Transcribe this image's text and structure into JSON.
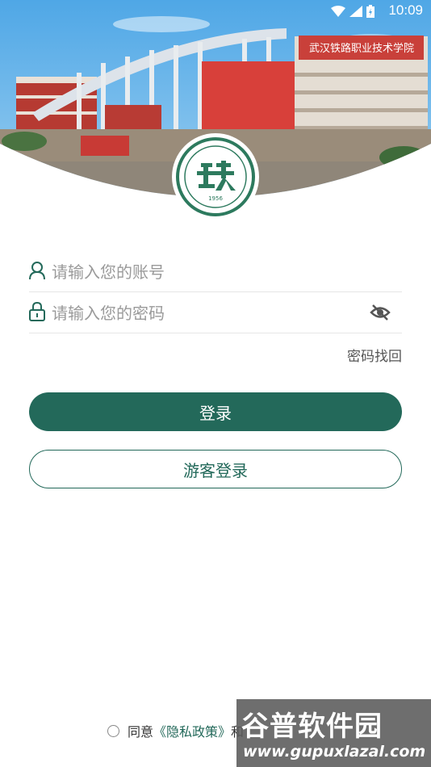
{
  "status_bar": {
    "time": "10:09"
  },
  "header": {
    "building_sign": "武汉铁路职业技术学院",
    "logo_year": "1956"
  },
  "form": {
    "account_placeholder": "请输入您的账号",
    "password_placeholder": "请输入您的密码",
    "recover_password": "密码找回"
  },
  "buttons": {
    "login": "登录",
    "guest_login": "游客登录"
  },
  "agreement": {
    "prefix": "同意",
    "privacy_link": "《隐私政策》",
    "suffix": "和"
  },
  "watermark": {
    "title": "谷普软件园",
    "url": "www.gupuxlazal.com"
  },
  "colors": {
    "primary": "#23695a",
    "placeholder": "#9a9a9a",
    "divider": "#e6e6e6"
  }
}
